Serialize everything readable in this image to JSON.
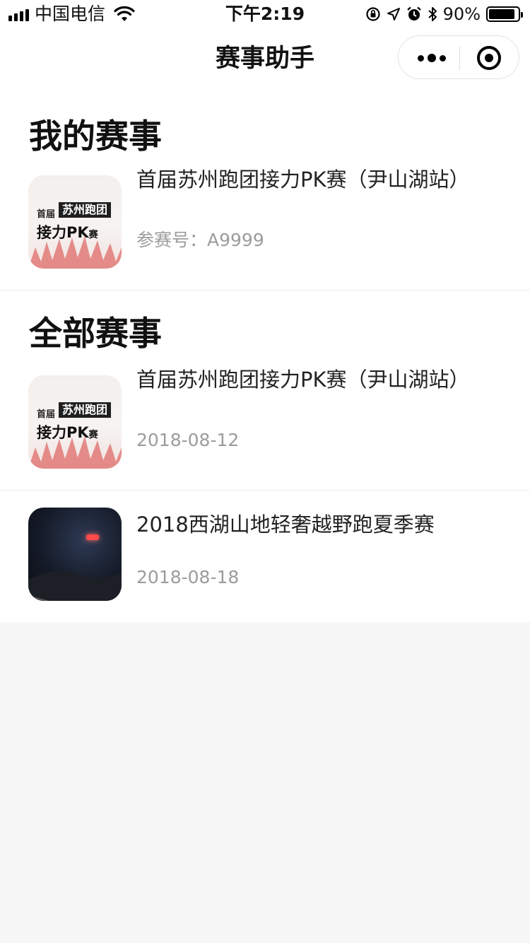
{
  "status_bar": {
    "carrier": "中国电信",
    "time": "下午2:19",
    "battery_percent": "90%",
    "battery_level": 0.9,
    "icons": [
      "signal-icon",
      "wifi-icon",
      "rotation-lock-icon",
      "location-icon",
      "alarm-icon",
      "bluetooth-icon",
      "battery-icon"
    ]
  },
  "nav": {
    "title": "赛事助手",
    "capsule_icons": [
      "more-icon",
      "close-target-icon"
    ]
  },
  "my_events": {
    "title": "我的赛事",
    "items": [
      {
        "title": "首届苏州跑团接力PK赛（尹山湖站）",
        "subtitle": "参赛号：A9999",
        "thumb_text": {
          "small": "首届",
          "band": "苏州跑团",
          "big": "接力PK",
          "big_small": "赛"
        }
      }
    ]
  },
  "all_events": {
    "title": "全部赛事",
    "items": [
      {
        "title": "首届苏州跑团接力PK赛（尹山湖站）",
        "date": "2018-08-12",
        "thumb_text": {
          "small": "首届",
          "band": "苏州跑团",
          "big": "接力PK",
          "big_small": "赛"
        }
      },
      {
        "title": "2018西湖山地轻奢越野跑夏季赛",
        "date": "2018-08-18"
      }
    ]
  },
  "colors": {
    "page_background": "#f7f7f7",
    "card_background": "#ffffff",
    "secondary_text": "#9c9c9c",
    "thumb_accent": "#e07a78"
  }
}
